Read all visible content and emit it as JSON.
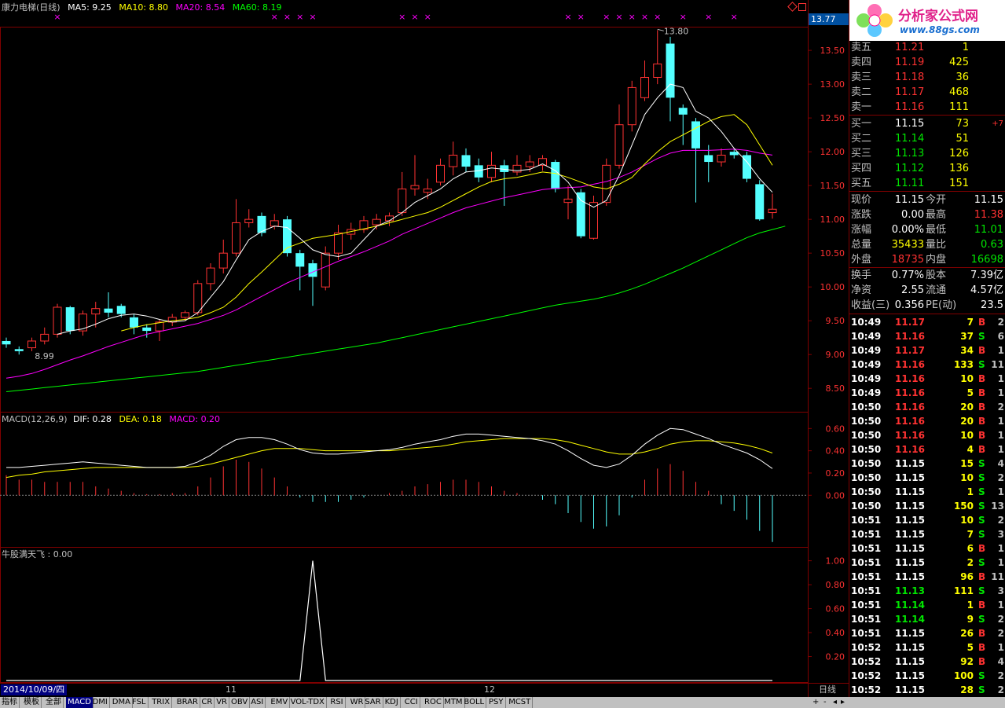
{
  "stock_title": "康力电梯(日线)",
  "ma_labels": [
    {
      "text": "MA5: 9.25",
      "color": "#ffffff"
    },
    {
      "text": "MA10: 8.80",
      "color": "#ffff00"
    },
    {
      "text": "MA20: 8.54",
      "color": "#ff00ff"
    },
    {
      "text": "MA60: 8.19",
      "color": "#00ff00"
    }
  ],
  "price_box": "13.77",
  "price_axis": [
    "13.50",
    "13.00",
    "12.50",
    "12.00",
    "11.50",
    "11.00",
    "10.50",
    "10.00",
    "9.50",
    "9.00",
    "8.50"
  ],
  "high_marker": "13.80",
  "low_marker": "8.99",
  "macd_header": {
    "label": "MACD(12,26,9)",
    "dif": "DIF: 0.28",
    "dea": "DEA: 0.18",
    "macd": "MACD: 0.20"
  },
  "macd_axis": [
    "0.60",
    "0.40",
    "0.20",
    "0.00"
  ],
  "ind_header": "牛股满天飞 : 0.00",
  "ind_axis": [
    "1.00",
    "0.80",
    "0.60",
    "0.40",
    "0.20"
  ],
  "date_label": "2014/10/09/四",
  "month_labels": [
    "11",
    "12"
  ],
  "period_label": "日线",
  "logo": {
    "title": "分析家公式网",
    "url": "www.88gs.com"
  },
  "sell_orders": [
    {
      "label": "卖五",
      "price": "11.21",
      "vol": "1"
    },
    {
      "label": "卖四",
      "price": "11.19",
      "vol": "425"
    },
    {
      "label": "卖三",
      "price": "11.18",
      "vol": "36"
    },
    {
      "label": "卖二",
      "price": "11.17",
      "vol": "468"
    },
    {
      "label": "卖一",
      "price": "11.16",
      "vol": "111"
    }
  ],
  "buy_orders": [
    {
      "label": "买一",
      "price": "11.15",
      "vol": "73",
      "chg": "+7"
    },
    {
      "label": "买二",
      "price": "11.14",
      "vol": "51",
      "chg": ""
    },
    {
      "label": "买三",
      "price": "11.13",
      "vol": "126",
      "chg": ""
    },
    {
      "label": "买四",
      "price": "11.12",
      "vol": "136",
      "chg": ""
    },
    {
      "label": "买五",
      "price": "11.11",
      "vol": "151",
      "chg": ""
    }
  ],
  "quote_stats": [
    {
      "l1": "现价",
      "v1": "11.15",
      "c1": "#ffffff",
      "l2": "今开",
      "v2": "11.15",
      "c2": "#ffffff"
    },
    {
      "l1": "涨跌",
      "v1": "0.00",
      "c1": "#ffffff",
      "l2": "最高",
      "v2": "11.38",
      "c2": "#ff3232"
    },
    {
      "l1": "涨幅",
      "v1": "0.00%",
      "c1": "#ffffff",
      "l2": "最低",
      "v2": "11.01",
      "c2": "#00e600"
    },
    {
      "l1": "总量",
      "v1": "35433",
      "c1": "#ffff00",
      "l2": "量比",
      "v2": "0.63",
      "c2": "#00e600"
    },
    {
      "l1": "外盘",
      "v1": "18735",
      "c1": "#ff3232",
      "l2": "内盘",
      "v2": "16698",
      "c2": "#00e600"
    }
  ],
  "quote_fund": [
    {
      "l1": "换手",
      "v1": "0.77%",
      "l2": "股本",
      "v2": "7.39亿"
    },
    {
      "l1": "净资",
      "v1": "2.55",
      "l2": "流通",
      "v2": "4.57亿"
    },
    {
      "l1": "收益(三)",
      "v1": "0.356",
      "l2": "PE(动)",
      "v2": "23.5"
    }
  ],
  "ticks": [
    {
      "t": "10:49",
      "p": "11.17",
      "v": "7",
      "s": "B",
      "n": "2"
    },
    {
      "t": "10:49",
      "p": "11.16",
      "v": "37",
      "s": "S",
      "n": "6"
    },
    {
      "t": "10:49",
      "p": "11.17",
      "v": "34",
      "s": "B",
      "n": "1"
    },
    {
      "t": "10:49",
      "p": "11.16",
      "v": "133",
      "s": "S",
      "n": "11"
    },
    {
      "t": "10:49",
      "p": "11.16",
      "v": "10",
      "s": "B",
      "n": "1"
    },
    {
      "t": "10:49",
      "p": "11.16",
      "v": "5",
      "s": "B",
      "n": "1"
    },
    {
      "t": "10:50",
      "p": "11.16",
      "v": "20",
      "s": "B",
      "n": "2"
    },
    {
      "t": "10:50",
      "p": "11.16",
      "v": "20",
      "s": "B",
      "n": "1"
    },
    {
      "t": "10:50",
      "p": "11.16",
      "v": "10",
      "s": "B",
      "n": "1"
    },
    {
      "t": "10:50",
      "p": "11.16",
      "v": "4",
      "s": "B",
      "n": "1"
    },
    {
      "t": "10:50",
      "p": "11.15",
      "v": "15",
      "s": "S",
      "n": "4"
    },
    {
      "t": "10:50",
      "p": "11.15",
      "v": "10",
      "s": "S",
      "n": "2"
    },
    {
      "t": "10:50",
      "p": "11.15",
      "v": "1",
      "s": "S",
      "n": "1"
    },
    {
      "t": "10:50",
      "p": "11.15",
      "v": "150",
      "s": "S",
      "n": "13"
    },
    {
      "t": "10:51",
      "p": "11.15",
      "v": "10",
      "s": "S",
      "n": "2"
    },
    {
      "t": "10:51",
      "p": "11.15",
      "v": "7",
      "s": "S",
      "n": "3"
    },
    {
      "t": "10:51",
      "p": "11.15",
      "v": "6",
      "s": "B",
      "n": "1"
    },
    {
      "t": "10:51",
      "p": "11.15",
      "v": "2",
      "s": "S",
      "n": "1"
    },
    {
      "t": "10:51",
      "p": "11.15",
      "v": "96",
      "s": "B",
      "n": "11"
    },
    {
      "t": "10:51",
      "p": "11.13",
      "v": "111",
      "s": "S",
      "n": "3"
    },
    {
      "t": "10:51",
      "p": "11.14",
      "v": "1",
      "s": "B",
      "n": "1"
    },
    {
      "t": "10:51",
      "p": "11.14",
      "v": "9",
      "s": "S",
      "n": "2"
    },
    {
      "t": "10:51",
      "p": "11.15",
      "v": "26",
      "s": "B",
      "n": "2"
    },
    {
      "t": "10:52",
      "p": "11.15",
      "v": "5",
      "s": "B",
      "n": "1"
    },
    {
      "t": "10:52",
      "p": "11.15",
      "v": "92",
      "s": "B",
      "n": "4"
    },
    {
      "t": "10:52",
      "p": "11.15",
      "v": "100",
      "s": "S",
      "n": "2"
    },
    {
      "t": "10:52",
      "p": "11.15",
      "v": "28",
      "s": "S",
      "n": "2"
    }
  ],
  "bottom_tabs": [
    "指标",
    "模板",
    "全部",
    "MACD",
    "DMI",
    "DMA",
    "FSL",
    "TRIX",
    "BRAR",
    "CR",
    "VR",
    "OBV",
    "ASI",
    "EMV",
    "VOL-TDX",
    "RSI",
    "WR",
    "SAR",
    "KDJ",
    "CCI",
    "ROC",
    "MTM",
    "BOLL",
    "PSY",
    "MCST"
  ],
  "colors": {
    "up": "#ff3232",
    "down": "#54ffff",
    "ma5": "#ffffff",
    "ma10": "#ffff00",
    "ma20": "#ff00ff",
    "ma60": "#00ff00",
    "frame": "#800000"
  },
  "chart_data": {
    "type": "candlestick",
    "price_range": [
      8.2,
      13.85
    ],
    "candles": [
      [
        9.2,
        9.15,
        9.25,
        9.1
      ],
      [
        9.08,
        9.05,
        9.12,
        9.0
      ],
      [
        9.1,
        9.2,
        9.25,
        9.05
      ],
      [
        9.2,
        9.3,
        9.4,
        9.15
      ],
      [
        9.3,
        9.7,
        9.75,
        9.25
      ],
      [
        9.7,
        9.35,
        9.72,
        9.3
      ],
      [
        9.35,
        9.6,
        9.65,
        9.28
      ],
      [
        9.6,
        9.68,
        9.78,
        9.4
      ],
      [
        9.68,
        9.62,
        9.92,
        9.55
      ],
      [
        9.72,
        9.6,
        9.75,
        9.55
      ],
      [
        9.55,
        9.4,
        9.6,
        9.3
      ],
      [
        9.4,
        9.35,
        9.45,
        9.25
      ],
      [
        9.35,
        9.48,
        9.52,
        9.2
      ],
      [
        9.48,
        9.55,
        9.6,
        9.42
      ],
      [
        9.55,
        9.62,
        9.65,
        9.5
      ],
      [
        9.62,
        10.05,
        10.1,
        9.58
      ],
      [
        10.05,
        10.28,
        10.35,
        9.95
      ],
      [
        10.28,
        10.5,
        10.7,
        10.2
      ],
      [
        10.5,
        10.95,
        11.3,
        10.45
      ],
      [
        10.95,
        11.0,
        11.15,
        10.88
      ],
      [
        11.05,
        10.8,
        11.1,
        10.75
      ],
      [
        10.9,
        10.98,
        11.08,
        10.85
      ],
      [
        11.0,
        10.5,
        11.05,
        10.45
      ],
      [
        10.5,
        10.3,
        10.55,
        9.95
      ],
      [
        10.35,
        10.15,
        10.4,
        9.72
      ],
      [
        10.0,
        10.5,
        10.6,
        9.95
      ],
      [
        10.5,
        10.8,
        10.92,
        10.4
      ],
      [
        10.78,
        10.85,
        10.95,
        10.7
      ],
      [
        10.85,
        10.98,
        11.05,
        10.8
      ],
      [
        10.92,
        11.0,
        11.08,
        10.85
      ],
      [
        10.98,
        11.05,
        11.1,
        10.9
      ],
      [
        11.1,
        11.45,
        11.7,
        11.05
      ],
      [
        11.45,
        11.5,
        11.95,
        11.35
      ],
      [
        11.4,
        11.45,
        11.6,
        11.3
      ],
      [
        11.55,
        11.8,
        11.9,
        11.5
      ],
      [
        11.78,
        11.95,
        12.15,
        11.65
      ],
      [
        11.95,
        11.78,
        12.05,
        11.7
      ],
      [
        11.8,
        11.62,
        11.9,
        11.55
      ],
      [
        11.62,
        11.8,
        12.0,
        11.55
      ],
      [
        11.8,
        11.7,
        11.88,
        11.2
      ],
      [
        11.7,
        11.8,
        11.95,
        11.65
      ],
      [
        11.78,
        11.85,
        11.95,
        11.7
      ],
      [
        11.8,
        11.9,
        11.95,
        11.72
      ],
      [
        11.85,
        11.45,
        11.88,
        11.4
      ],
      [
        11.25,
        11.3,
        11.5,
        11.0
      ],
      [
        11.4,
        10.75,
        11.45,
        10.72
      ],
      [
        10.72,
        11.25,
        11.35,
        10.7
      ],
      [
        11.25,
        11.8,
        11.9,
        11.2
      ],
      [
        11.8,
        12.4,
        12.7,
        11.75
      ],
      [
        12.4,
        12.95,
        13.05,
        12.3
      ],
      [
        12.8,
        13.1,
        13.35,
        12.75
      ],
      [
        13.1,
        13.3,
        13.8,
        13.0
      ],
      [
        13.6,
        12.8,
        13.7,
        12.45
      ],
      [
        12.65,
        12.55,
        12.7,
        12.1
      ],
      [
        12.45,
        12.05,
        12.5,
        11.25
      ],
      [
        11.95,
        11.85,
        12.1,
        11.55
      ],
      [
        11.85,
        11.95,
        12.05,
        11.78
      ],
      [
        12.0,
        11.95,
        12.05,
        11.9
      ],
      [
        11.95,
        11.6,
        12.0,
        11.55
      ],
      [
        11.52,
        11.0,
        11.58,
        10.98
      ],
      [
        11.1,
        11.15,
        11.38,
        11.01
      ]
    ],
    "ma5": [
      null,
      null,
      null,
      null,
      9.3,
      9.35,
      9.38,
      9.45,
      9.53,
      9.58,
      9.6,
      9.57,
      9.52,
      9.48,
      9.5,
      9.62,
      9.85,
      10.08,
      10.4,
      10.7,
      10.82,
      10.9,
      10.88,
      10.72,
      10.55,
      10.48,
      10.45,
      10.5,
      10.7,
      10.9,
      10.98,
      11.1,
      11.25,
      11.35,
      11.45,
      11.6,
      11.7,
      11.72,
      11.76,
      11.74,
      11.72,
      11.74,
      11.82,
      11.72,
      11.55,
      11.28,
      11.18,
      11.28,
      11.65,
      12.1,
      12.55,
      12.8,
      13.0,
      12.95,
      12.6,
      12.5,
      12.3,
      12.05,
      11.85,
      11.6,
      11.4
    ],
    "ma10": [
      null,
      null,
      null,
      null,
      null,
      null,
      null,
      null,
      null,
      9.35,
      9.4,
      9.44,
      9.47,
      9.5,
      9.52,
      9.55,
      9.62,
      9.7,
      9.85,
      10.05,
      10.22,
      10.4,
      10.58,
      10.65,
      10.72,
      10.75,
      10.78,
      10.82,
      10.86,
      10.9,
      10.95,
      11.0,
      11.05,
      11.1,
      11.18,
      11.28,
      11.38,
      11.48,
      11.56,
      11.6,
      11.62,
      11.66,
      11.7,
      11.68,
      11.62,
      11.55,
      11.48,
      11.45,
      11.52,
      11.62,
      11.82,
      12.0,
      12.15,
      12.25,
      12.35,
      12.45,
      12.52,
      12.55,
      12.4,
      12.1,
      11.8
    ],
    "ma20": [
      8.65,
      8.68,
      8.72,
      8.78,
      8.85,
      8.92,
      8.98,
      9.05,
      9.12,
      9.18,
      9.24,
      9.3,
      9.34,
      9.38,
      9.42,
      9.46,
      9.52,
      9.58,
      9.66,
      9.76,
      9.86,
      9.96,
      10.06,
      10.14,
      10.22,
      10.3,
      10.38,
      10.45,
      10.52,
      10.6,
      10.68,
      10.78,
      10.86,
      10.94,
      11.02,
      11.1,
      11.17,
      11.22,
      11.27,
      11.32,
      11.36,
      11.4,
      11.44,
      11.46,
      11.47,
      11.48,
      11.52,
      11.56,
      11.62,
      11.7,
      11.8,
      11.9,
      11.98,
      12.02,
      12.02,
      12.02,
      12.03,
      12.04,
      12.02,
      11.98,
      11.95
    ],
    "ma60": [
      8.45,
      8.47,
      8.49,
      8.51,
      8.53,
      8.55,
      8.57,
      8.59,
      8.61,
      8.63,
      8.65,
      8.67,
      8.69,
      8.71,
      8.73,
      8.75,
      8.78,
      8.81,
      8.84,
      8.87,
      8.9,
      8.93,
      8.96,
      8.99,
      9.02,
      9.05,
      9.08,
      9.11,
      9.14,
      9.17,
      9.21,
      9.25,
      9.29,
      9.33,
      9.37,
      9.41,
      9.45,
      9.49,
      9.53,
      9.57,
      9.61,
      9.65,
      9.69,
      9.73,
      9.76,
      9.79,
      9.82,
      9.86,
      9.91,
      9.97,
      10.04,
      10.12,
      10.2,
      10.28,
      10.37,
      10.46,
      10.55,
      10.64,
      10.73,
      10.8,
      10.85,
      10.9
    ],
    "macd_range": [
      -0.45,
      0.68
    ],
    "dif": [
      0.25,
      0.25,
      0.26,
      0.27,
      0.28,
      0.29,
      0.3,
      0.29,
      0.28,
      0.27,
      0.26,
      0.25,
      0.25,
      0.25,
      0.26,
      0.3,
      0.36,
      0.44,
      0.5,
      0.52,
      0.52,
      0.5,
      0.46,
      0.41,
      0.38,
      0.37,
      0.37,
      0.38,
      0.39,
      0.4,
      0.41,
      0.43,
      0.46,
      0.48,
      0.5,
      0.53,
      0.55,
      0.55,
      0.54,
      0.53,
      0.52,
      0.51,
      0.49,
      0.46,
      0.4,
      0.33,
      0.27,
      0.25,
      0.28,
      0.36,
      0.46,
      0.54,
      0.6,
      0.59,
      0.55,
      0.51,
      0.46,
      0.42,
      0.38,
      0.32,
      0.24
    ],
    "dea": [
      0.16,
      0.18,
      0.19,
      0.21,
      0.22,
      0.23,
      0.24,
      0.25,
      0.25,
      0.25,
      0.25,
      0.25,
      0.25,
      0.25,
      0.25,
      0.26,
      0.28,
      0.31,
      0.34,
      0.37,
      0.4,
      0.42,
      0.42,
      0.42,
      0.41,
      0.4,
      0.4,
      0.4,
      0.4,
      0.4,
      0.4,
      0.41,
      0.42,
      0.43,
      0.44,
      0.46,
      0.48,
      0.49,
      0.5,
      0.51,
      0.51,
      0.51,
      0.51,
      0.5,
      0.48,
      0.45,
      0.42,
      0.39,
      0.37,
      0.37,
      0.39,
      0.42,
      0.46,
      0.48,
      0.49,
      0.49,
      0.48,
      0.47,
      0.45,
      0.42,
      0.38
    ],
    "macd": [
      0.18,
      0.14,
      0.14,
      0.12,
      0.12,
      0.12,
      0.12,
      0.08,
      0.06,
      0.04,
      0.02,
      0.01,
      0.01,
      0.02,
      0.02,
      0.08,
      0.16,
      0.26,
      0.32,
      0.3,
      0.24,
      0.16,
      0.08,
      -0.02,
      -0.06,
      -0.06,
      -0.06,
      -0.04,
      -0.02,
      0.0,
      0.02,
      0.04,
      0.08,
      0.1,
      0.12,
      0.14,
      0.14,
      0.12,
      0.08,
      0.04,
      0.02,
      0.0,
      -0.04,
      -0.08,
      -0.16,
      -0.24,
      -0.3,
      -0.28,
      -0.18,
      -0.02,
      0.14,
      0.24,
      0.28,
      0.22,
      0.12,
      0.04,
      -0.08,
      -0.14,
      -0.22,
      -0.32,
      -0.42
    ],
    "ind_range": [
      0,
      1.05
    ],
    "signal": [
      0,
      0,
      0,
      0,
      0,
      0,
      0,
      0,
      0,
      0,
      0,
      0,
      0,
      0,
      0,
      0,
      0,
      0,
      0,
      0,
      0,
      0,
      0,
      0,
      1,
      0,
      0,
      0,
      0,
      0,
      0,
      0,
      0,
      0,
      0,
      0,
      0,
      0,
      0,
      0,
      0,
      0,
      0,
      0,
      0,
      0,
      0,
      0,
      0,
      0,
      0,
      0,
      0,
      0,
      0,
      0,
      0,
      0,
      0,
      0,
      0
    ],
    "signal_markers": [
      4,
      21,
      22,
      23,
      24,
      31,
      32,
      33,
      44,
      45,
      47,
      48,
      49,
      50,
      51,
      53,
      55,
      57
    ]
  }
}
